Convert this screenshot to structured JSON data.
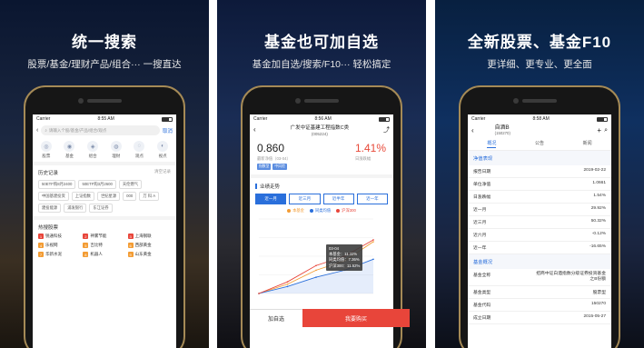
{
  "panel1": {
    "headline": "统一搜索",
    "subline": "股票/基金/理财产品/组合··· 一搜直达",
    "status": {
      "carrier": "Carrier",
      "time": "8:55 AM"
    },
    "search": {
      "placeholder": "请输入个股/基金/产品/组合/观点",
      "button": "取消"
    },
    "categories": [
      {
        "label": "股票",
        "icon": "stock-icon",
        "glyph": "◎"
      },
      {
        "label": "基金",
        "icon": "fund-icon",
        "glyph": "◉"
      },
      {
        "label": "组合",
        "icon": "portfolio-icon",
        "glyph": "◈"
      },
      {
        "label": "理财",
        "icon": "wealth-icon",
        "glyph": "◍"
      },
      {
        "label": "观点",
        "icon": "opinion-icon",
        "glyph": "◌"
      },
      {
        "label": "视点",
        "icon": "viewpoint-icon",
        "glyph": "◐"
      }
    ],
    "history_title": "历史记录",
    "clear_label": "清空记录",
    "history": [
      "50ETF购8月2400",
      "50ETF购3月2600",
      "天伦燃气",
      "中国基建投资",
      "上证指数",
      "世纪星源",
      "000",
      "万 科 A",
      "建投能源",
      "浦发银行",
      "东江证券"
    ],
    "hot_title": "热搜股票",
    "hot": [
      {
        "rank": "1",
        "name": "锐通科技",
        "color": "#e8453a"
      },
      {
        "rank": "2",
        "name": "神雾节能",
        "color": "#e8453a"
      },
      {
        "rank": "3",
        "name": "上海钢联",
        "color": "#e8453a"
      },
      {
        "rank": "4",
        "name": "乐视网",
        "color": "#f39c34"
      },
      {
        "rank": "5",
        "name": "吉比特",
        "color": "#f39c34"
      },
      {
        "rank": "6",
        "name": "西部黄金",
        "color": "#f39c34"
      },
      {
        "rank": "7",
        "name": "华新水泥",
        "color": "#f39c34"
      },
      {
        "rank": "8",
        "name": "机器人",
        "color": "#f39c34"
      },
      {
        "rank": "9",
        "name": "山东黄金",
        "color": "#f39c34"
      }
    ]
  },
  "panel2": {
    "headline": "基金也可加自选",
    "subline": "基金加自选/搜索/F10··· 轻松搞定",
    "status": {
      "carrier": "Carrier",
      "time": "8:56 AM"
    },
    "title": "广发中证基建工程指数C类",
    "code": "(005224)",
    "nav_value": "0.860",
    "nav_label": "最新净值（03-04）",
    "change": "1.41%",
    "change_label": "日涨跌幅",
    "tags": [
      "指数型",
      "中风险"
    ],
    "trend_title": "业绩走势",
    "periods": [
      "近一月",
      "近三月",
      "近半年",
      "近一年"
    ],
    "active_period": 0,
    "legend": [
      {
        "name": "本基金",
        "color": "#f39c34"
      },
      {
        "name": "同类均值",
        "color": "#2a6fdb"
      },
      {
        "name": "沪深300",
        "color": "#e8453a"
      }
    ],
    "tooltip": {
      "date": "03-04",
      "l1": "本基金：11.11%",
      "l2": "同类均值：7.36%",
      "l3": "沪深300：11.52%"
    },
    "btn_add": "加自选",
    "btn_buy": "我要购买"
  },
  "panel3": {
    "headline": "全新股票、基金F10",
    "subline": "更详细、更专业、更全面",
    "status": {
      "carrier": "Carrier",
      "time": "8:58 AM"
    },
    "title": "自酒B",
    "code": "(150270)",
    "tabs": [
      "概况",
      "公告",
      "新闻"
    ],
    "section1": "净值表现",
    "rows1": [
      {
        "k": "报告日期",
        "v": "2019-02-22"
      },
      {
        "k": "单位净值",
        "v": "1.0661"
      },
      {
        "k": "日涨跌幅",
        "v": "1.54%"
      },
      {
        "k": "近一月",
        "v": "29.92%"
      },
      {
        "k": "近三月",
        "v": "50.32%"
      },
      {
        "k": "近六月",
        "v": "-0.12%"
      },
      {
        "k": "近一年",
        "v": "-16.65%"
      }
    ],
    "section2": "基金概况",
    "rows2": [
      {
        "k": "基金全称",
        "v": "招商中证白酒指数分级证券投资基金之B份额"
      },
      {
        "k": "基金类型",
        "v": "股票型"
      },
      {
        "k": "基金代码",
        "v": "150270"
      },
      {
        "k": "成立日期",
        "v": "2015-05-27"
      }
    ]
  },
  "chart_data": {
    "type": "line",
    "x": [
      "02-04",
      "02-11",
      "02-18",
      "02-25",
      "03-04"
    ],
    "series": [
      {
        "name": "本基金",
        "values": [
          0.0,
          2.0,
          5.0,
          7.0,
          11.11
        ]
      },
      {
        "name": "同类均值",
        "values": [
          0.0,
          1.5,
          3.5,
          5.0,
          7.36
        ]
      },
      {
        "name": "沪深300",
        "values": [
          0.0,
          2.5,
          6.0,
          8.0,
          11.52
        ]
      }
    ],
    "ylim": [
      0,
      16
    ]
  }
}
